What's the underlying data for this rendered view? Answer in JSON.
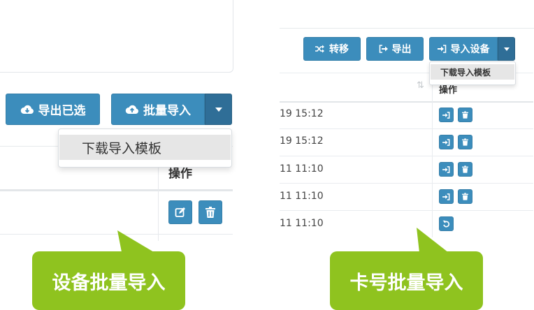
{
  "left_panel": {
    "export_selected_label": "导出已选",
    "batch_import_label": "批量导入",
    "dropdown_item_label": "下载导入模板",
    "operation_header": "操作"
  },
  "right_panel": {
    "transfer_label": "转移",
    "export_label": "导出",
    "import_device_label": "导入设备",
    "dropdown_item_label": "下载导入模板",
    "operation_header": "操作",
    "rows": [
      {
        "time": "19 15:12",
        "actions": [
          "login-icon",
          "trash-icon"
        ]
      },
      {
        "time": "19 15:12",
        "actions": [
          "login-icon",
          "trash-icon"
        ]
      },
      {
        "time": "11 11:10",
        "actions": [
          "login-icon",
          "trash-icon"
        ]
      },
      {
        "time": "11 11:10",
        "actions": [
          "login-icon",
          "trash-icon"
        ]
      },
      {
        "time": "11 11:10",
        "actions": [
          "undo-icon"
        ]
      }
    ]
  },
  "callouts": {
    "left": "设备批量导入",
    "right": "卡号批量导入"
  },
  "colors": {
    "primary": "#3c8dbc",
    "primary_dark": "#2f6e97",
    "callout_green": "#8fc31f"
  }
}
